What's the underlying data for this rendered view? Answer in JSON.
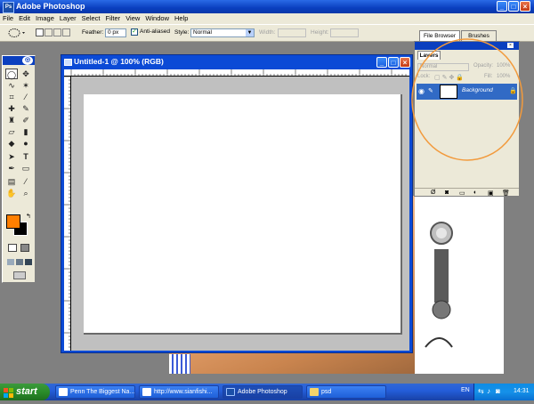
{
  "window": {
    "title": "Adobe Photoshop",
    "logo_text": "Ps",
    "minimize": "_",
    "maximize": "□",
    "close": "×"
  },
  "menu": [
    "File",
    "Edit",
    "Image",
    "Layer",
    "Select",
    "Filter",
    "View",
    "Window",
    "Help"
  ],
  "options": {
    "feather_label": "Feather:",
    "feather_value": "0 px",
    "antialiased_label": "Anti-aliased",
    "antialiased_checked": true,
    "style_label": "Style:",
    "style_value": "Normal",
    "width_label": "Width:",
    "height_label": "Height:",
    "well_tabs": [
      "File Browser",
      "Brushes"
    ]
  },
  "document": {
    "title": "Untitled-1 @ 100% (RGB)"
  },
  "layers": {
    "tab_label": "Layers",
    "blend_mode": "Normal",
    "opacity_label": "Opacity:",
    "opacity_value": "100%",
    "lock_label": "Lock:",
    "fill_label": "Fill:",
    "fill_value": "100%",
    "layer_name": "Background"
  },
  "colors": {
    "foreground": "#ff7f00",
    "background": "#000000",
    "highlight_circle": "#f29a3c",
    "titlebar": "#0a3fbf"
  },
  "taskbar": {
    "start_label": "start",
    "items": [
      {
        "label": "Penn The Biggest Na..."
      },
      {
        "label": "http://www.sianfishi..."
      },
      {
        "label": "Adobe Photoshop"
      },
      {
        "label": "psd"
      }
    ],
    "language": "EN",
    "clock": "14:31"
  }
}
